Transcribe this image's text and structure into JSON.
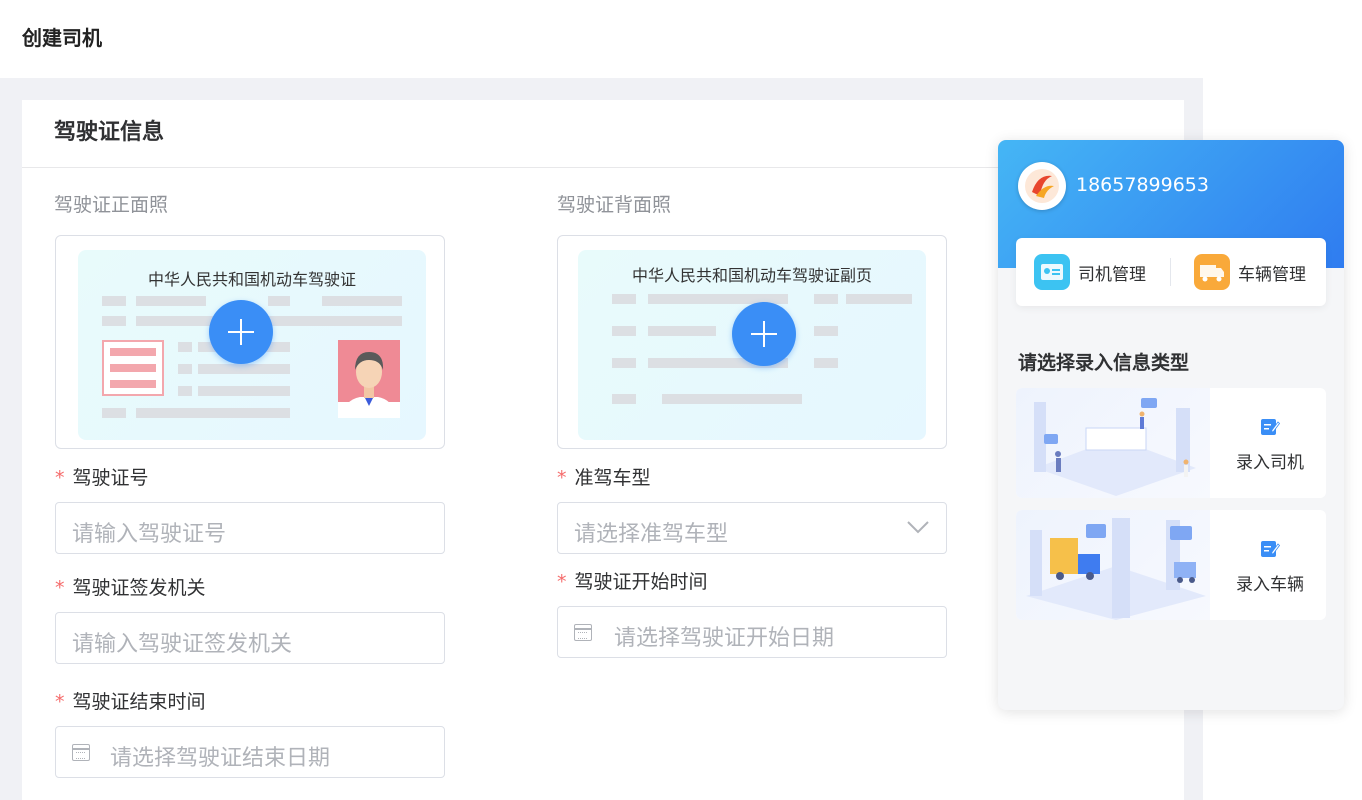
{
  "page": {
    "title": "创建司机"
  },
  "section": {
    "title": "驾驶证信息"
  },
  "photos": {
    "front_label": "驾驶证正面照",
    "back_label": "驾驶证背面照",
    "front_card_title": "中华人民共和国机动车驾驶证",
    "back_card_title": "中华人民共和国机动车驾驶证副页"
  },
  "fields": {
    "license_no": {
      "label": "驾驶证号",
      "placeholder": "请输入驾驶证号",
      "required": "*"
    },
    "vehicle_class": {
      "label": "准驾车型",
      "placeholder": "请选择准驾车型",
      "required": "*"
    },
    "issuing_authority": {
      "label": "驾驶证签发机关",
      "placeholder": "请输入驾驶证签发机关",
      "required": "*"
    },
    "start_date": {
      "label": "驾驶证开始时间",
      "placeholder": "请选择驾驶证开始日期",
      "required": "*"
    },
    "end_date": {
      "label": "驾驶证结束时间",
      "placeholder": "请选择驾驶证结束日期",
      "required": "*"
    }
  },
  "panel": {
    "phone": "18657899653",
    "quick": [
      {
        "label": "司机管理",
        "icon": "id-card-icon",
        "color": "#3cc3f2"
      },
      {
        "label": "车辆管理",
        "icon": "truck-icon",
        "color": "#f9a93a"
      }
    ],
    "section_title": "请选择录入信息类型",
    "entries": [
      {
        "label": "录入司机",
        "icon": "edit-icon"
      },
      {
        "label": "录入车辆",
        "icon": "edit-icon"
      }
    ]
  },
  "colors": {
    "primary": "#3a8ef6",
    "required": "#f56c6c",
    "panel_gradient_start": "#45b6f5",
    "panel_gradient_end": "#2f7cf0"
  }
}
